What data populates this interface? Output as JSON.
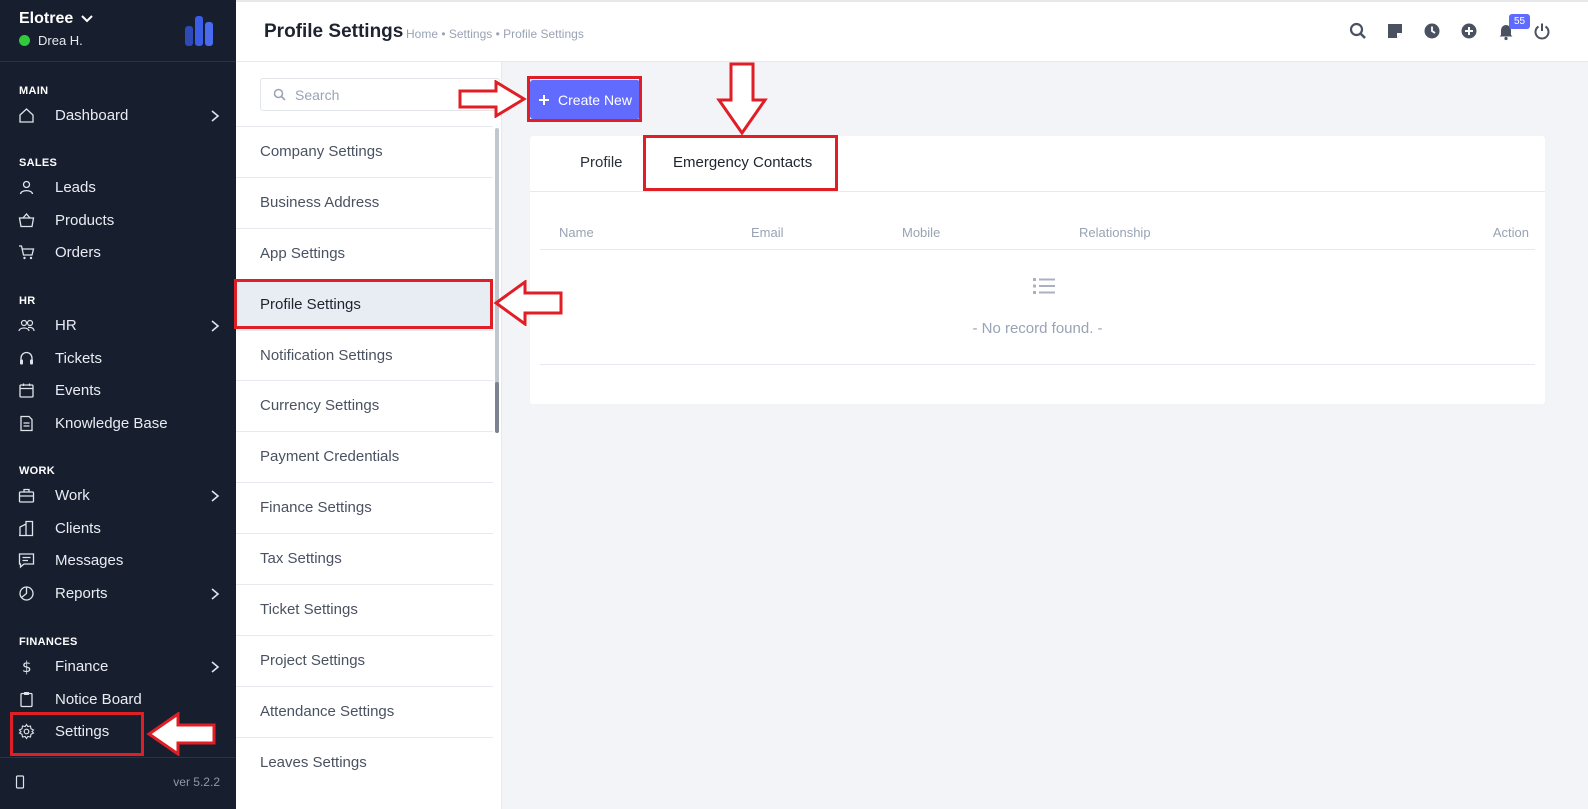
{
  "brand": {
    "name": "Elotree",
    "user": "Drea H."
  },
  "sidebar": {
    "sections": {
      "main": "MAIN",
      "sales": "SALES",
      "hr": "HR",
      "work": "WORK",
      "finances": "FINANCES"
    },
    "items": {
      "dashboard": "Dashboard",
      "leads": "Leads",
      "products": "Products",
      "orders": "Orders",
      "hr": "HR",
      "tickets": "Tickets",
      "events": "Events",
      "knowledge_base": "Knowledge Base",
      "work": "Work",
      "clients": "Clients",
      "messages": "Messages",
      "reports": "Reports",
      "finance": "Finance",
      "notice_board": "Notice Board",
      "settings": "Settings"
    },
    "version": "ver 5.2.2"
  },
  "header": {
    "title": "Profile Settings",
    "breadcrumb": "Home • Settings • Profile Settings",
    "notification_count": "55"
  },
  "settings_menu": {
    "search_placeholder": "Search",
    "items": [
      "Company Settings",
      "Business Address",
      "App Settings",
      "Profile Settings",
      "Notification Settings",
      "Currency Settings",
      "Payment Credentials",
      "Finance Settings",
      "Tax Settings",
      "Ticket Settings",
      "Project Settings",
      "Attendance Settings",
      "Leaves Settings"
    ],
    "active_index": 3
  },
  "content": {
    "create_button": "Create New",
    "tabs": [
      "Profile",
      "Emergency Contacts"
    ],
    "active_tab": 1,
    "columns": [
      "Name",
      "Email",
      "Mobile",
      "Relationship",
      "Action"
    ],
    "empty_text": "- No record found. -"
  },
  "colors": {
    "sidebar_bg": "#171f2f",
    "accent": "#616cff",
    "annotation_red": "#e01e26",
    "online": "#2fcb3a"
  }
}
